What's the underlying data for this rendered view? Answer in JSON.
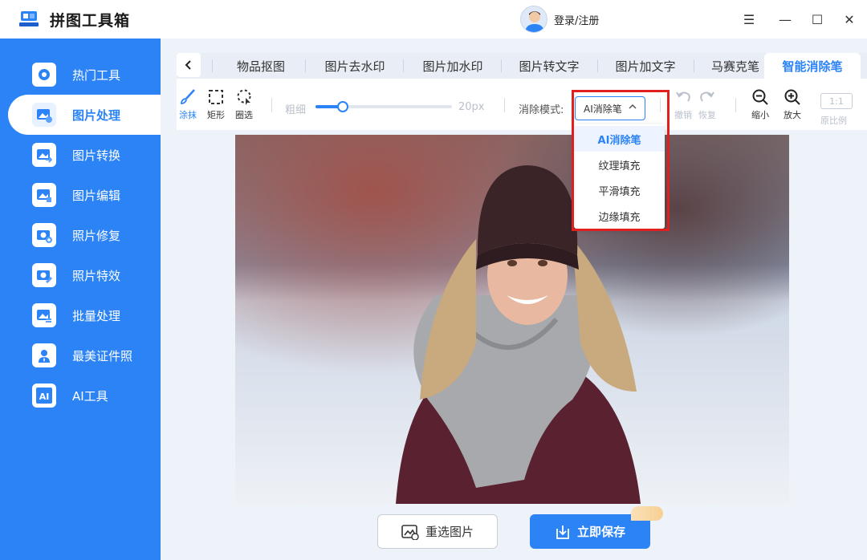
{
  "app": {
    "title": "拼图工具箱",
    "login_label": "登录/注册"
  },
  "window_controls": {
    "menu": "☰",
    "minimize": "—",
    "maximize": "☐",
    "close": "✕"
  },
  "sidebar": {
    "items": [
      {
        "label": "热门工具",
        "icon": "hot-tools-icon"
      },
      {
        "label": "图片处理",
        "icon": "image-process-icon",
        "active": true
      },
      {
        "label": "图片转换",
        "icon": "image-convert-icon"
      },
      {
        "label": "图片编辑",
        "icon": "image-edit-icon"
      },
      {
        "label": "照片修复",
        "icon": "photo-repair-icon"
      },
      {
        "label": "照片特效",
        "icon": "photo-effects-icon"
      },
      {
        "label": "批量处理",
        "icon": "batch-process-icon"
      },
      {
        "label": "最美证件照",
        "icon": "id-photo-icon"
      },
      {
        "label": "AI工具",
        "icon": "ai-tools-icon"
      }
    ]
  },
  "tabs": [
    {
      "label": "物品抠图"
    },
    {
      "label": "图片去水印"
    },
    {
      "label": "图片加水印"
    },
    {
      "label": "图片转文字"
    },
    {
      "label": "图片加文字"
    },
    {
      "label": "马赛克笔"
    },
    {
      "label": "智能消除笔",
      "active": true
    }
  ],
  "toolbar": {
    "paint_label": "涂抹",
    "rect_label": "矩形",
    "lasso_label": "圈选",
    "size_label": "粗细",
    "size_value": "20px",
    "size_fraction": 0.2,
    "mode_label": "消除模式:",
    "mode_selected": "AI消除笔",
    "undo_label": "撤销",
    "redo_label": "恢复",
    "zoom_out_label": "缩小",
    "zoom_in_label": "放大",
    "ratio_badge": "1:1",
    "original_label": "原比例"
  },
  "mode_options": [
    "AI消除笔",
    "纹理填充",
    "平滑填充",
    "边缘填充"
  ],
  "actions": {
    "reselect_label": "重选图片",
    "save_label": "立即保存"
  },
  "colors": {
    "brand": "#2b83f6",
    "highlight": "#e02020"
  }
}
